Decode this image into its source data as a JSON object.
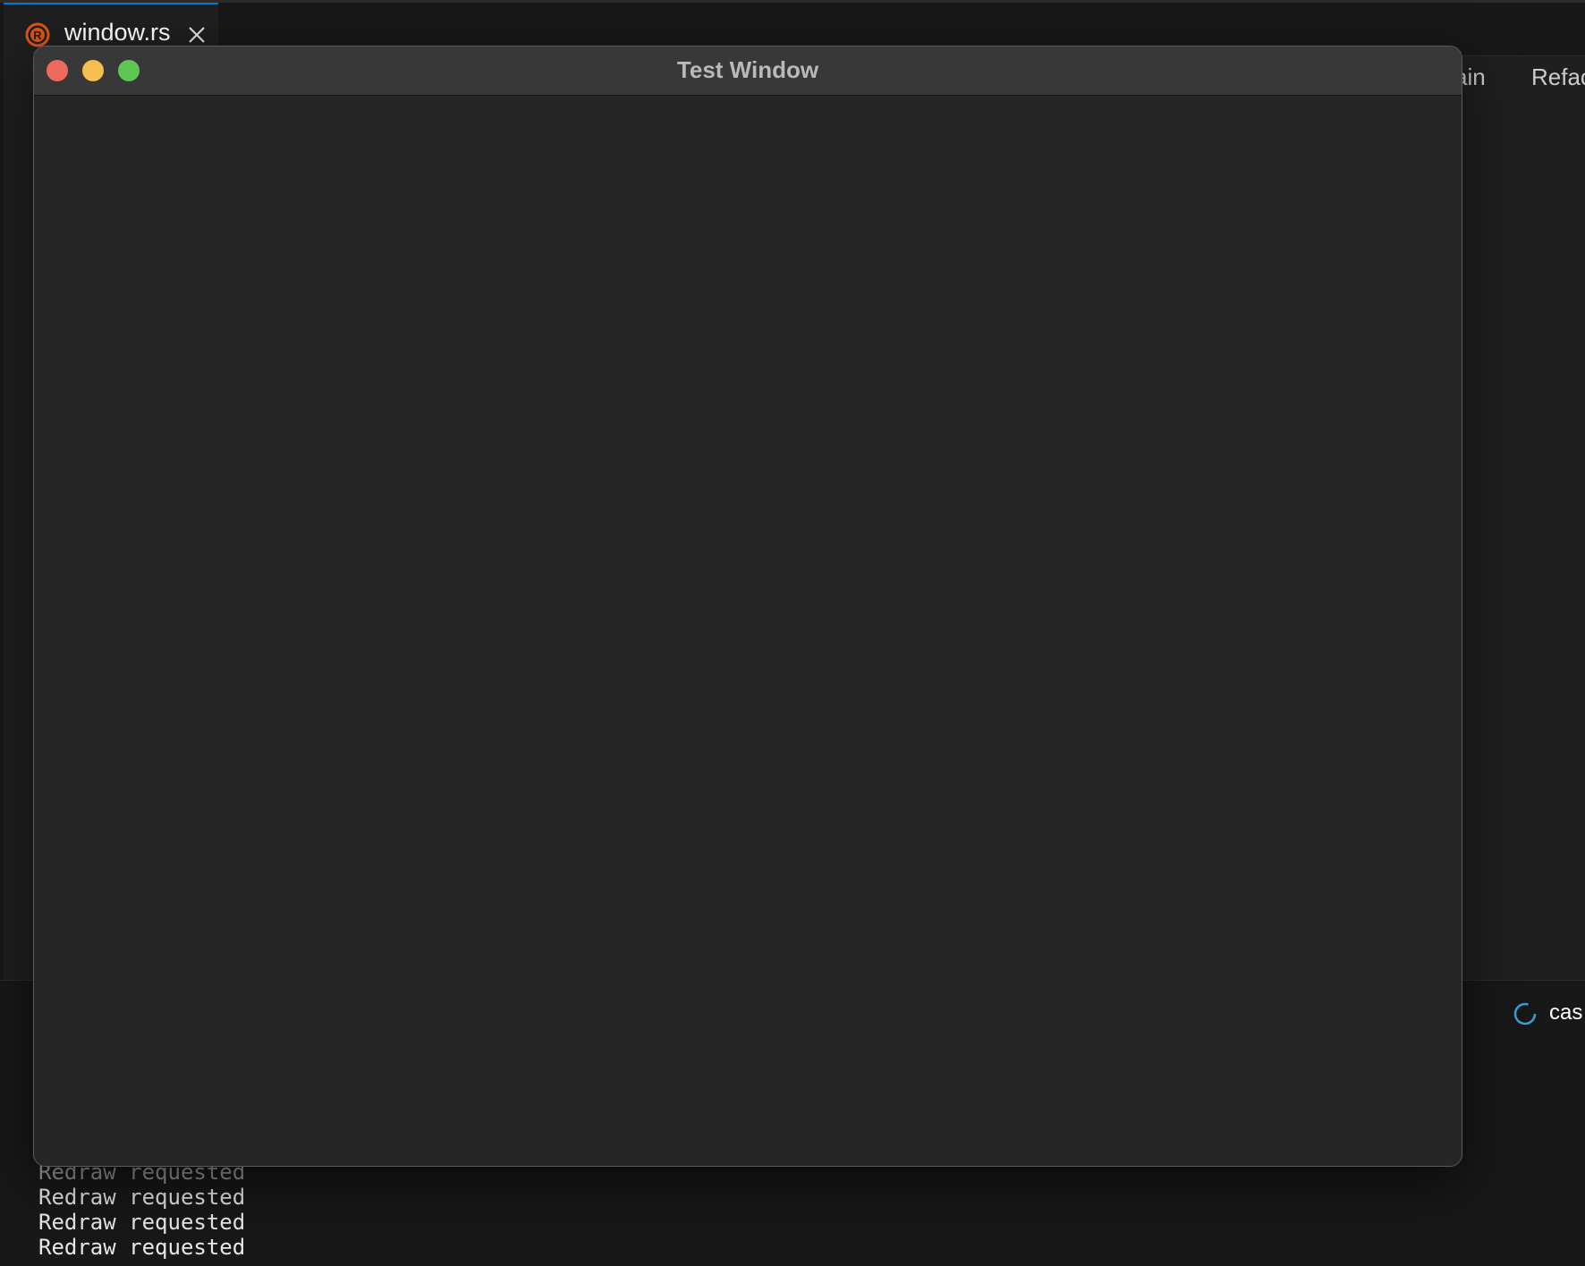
{
  "editor": {
    "tab": {
      "icon": "rust-icon",
      "label": "window.rs",
      "close_icon": "close-icon"
    },
    "codelens": {
      "main_label": "ain",
      "refactor_label": "Refac"
    }
  },
  "panel": {
    "status_icon": "spinner-icon",
    "status_text": "cas",
    "terminal_lines": [
      "Redraw requested",
      "Redraw requested",
      "Redraw requested",
      "Redraw requested"
    ]
  },
  "test_window": {
    "title": "Test Window",
    "buttons": {
      "close": "close-button",
      "minimize": "minimize-button",
      "zoom": "zoom-button"
    }
  },
  "colors": {
    "tab_accent": "#0078d4",
    "rust_icon": "#d9541a",
    "traffic_close": "#ed6a5e",
    "traffic_minimize": "#f5bf4f",
    "traffic_zoom": "#61c554",
    "spinner": "#3a9fd8"
  }
}
